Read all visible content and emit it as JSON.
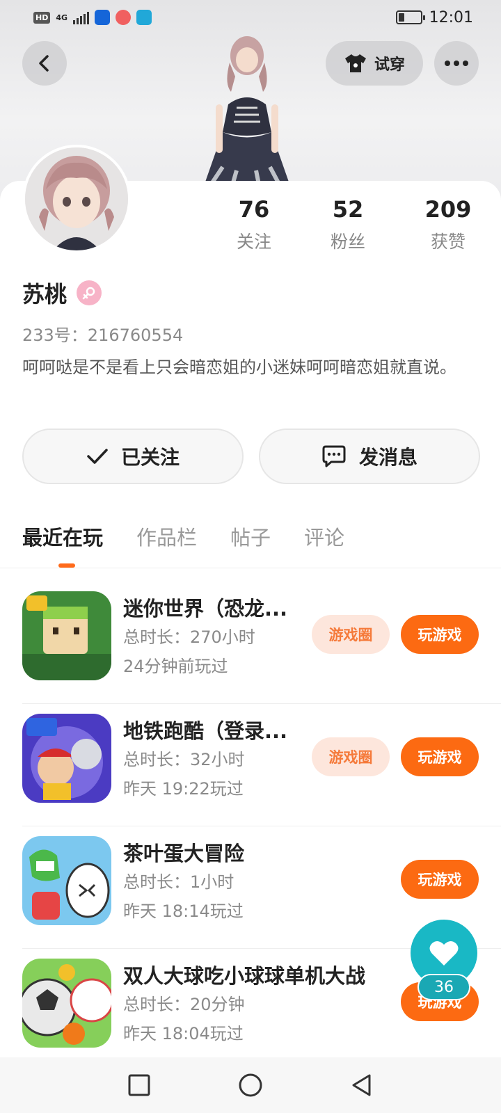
{
  "status_bar": {
    "network_badge": "HD",
    "network_type": "4G",
    "time": "12:01"
  },
  "header": {
    "tryon_label": "试穿"
  },
  "profile": {
    "name": "苏桃",
    "id_line": "233号：216760554",
    "bio": "呵呵哒是不是看上只会暗恋姐的小迷妹呵呵暗恋姐就直说。",
    "stats": [
      {
        "value": "76",
        "label": "关注"
      },
      {
        "value": "52",
        "label": "粉丝"
      },
      {
        "value": "209",
        "label": "获赞"
      }
    ]
  },
  "actions": {
    "follow_label": "已关注",
    "message_label": "发消息"
  },
  "tabs": [
    {
      "label": "最近在玩",
      "active": true
    },
    {
      "label": "作品栏",
      "active": false
    },
    {
      "label": "帖子",
      "active": false
    },
    {
      "label": "评论",
      "active": false
    }
  ],
  "games": [
    {
      "title": "迷你世界（恐龙...",
      "duration": "总时长：270小时",
      "last_played": "24分钟前玩过",
      "circle_label": "游戏圈",
      "play_label": "玩游戏",
      "has_circle": true
    },
    {
      "title": "地铁跑酷（登录...",
      "duration": "总时长：32小时",
      "last_played": "昨天 19:22玩过",
      "circle_label": "游戏圈",
      "play_label": "玩游戏",
      "has_circle": true
    },
    {
      "title": "茶叶蛋大冒险",
      "duration": "总时长：1小时",
      "last_played": "昨天 18:14玩过",
      "play_label": "玩游戏",
      "has_circle": false
    },
    {
      "title": "双人大球吃小球球单机大战",
      "duration": "总时长：20分钟",
      "last_played": "昨天 18:04玩过",
      "play_label": "玩游戏",
      "has_circle": false
    }
  ],
  "like_fab": {
    "count": "36"
  },
  "colors": {
    "accent": "#fc6a12",
    "circle_bg": "#fde6dc",
    "circle_text": "#f57a3a",
    "fab": "#19b8c5",
    "gender": "#f7b3c7"
  }
}
